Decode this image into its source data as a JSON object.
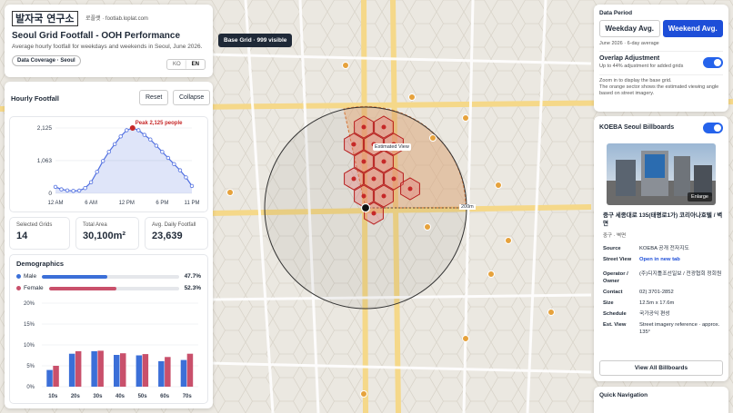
{
  "header": {
    "logo_text": "발자국 연구소",
    "logo_url": "로플랫 · footlab.loplat.com",
    "title": "Seoul Grid Footfall - OOH Performance",
    "subtitle": "Average hourly footfall for weekdays and weekends in Seoul, June 2026.",
    "coverage_label": "Data Coverage · Seoul",
    "lang_ko": "KO",
    "lang_en": "EN",
    "lang_selected": "EN"
  },
  "map": {
    "badge": "Base Grid · 999 visible",
    "view_label": "Estimated View",
    "radius_label": "200m",
    "colors": {
      "hex_fill": "#e57373",
      "hex_stroke": "#b71c1c",
      "sector": "#f4b27a",
      "poi": "#e6a23c"
    }
  },
  "hourly": {
    "title": "Hourly Footfall",
    "reset_label": "Reset",
    "collapse_label": "Collapse",
    "peak_label": "Peak 2,125 people"
  },
  "stats": {
    "selected_grids_label": "Selected Grids",
    "selected_grids_value": "14",
    "total_area_label": "Total Area",
    "total_area_value": "30,100m²",
    "avg_footfall_label": "Avg. Daily Footfall",
    "avg_footfall_value": "23,639"
  },
  "demographics": {
    "title": "Demographics",
    "male_label": "Male",
    "male_pct": "47.7%",
    "male_value": 47.7,
    "female_label": "Female",
    "female_pct": "52.3%",
    "female_value": 52.3,
    "male_color": "#3b6fd8",
    "female_color": "#c9506b"
  },
  "chart_data": [
    {
      "type": "area",
      "x": [
        0,
        1,
        2,
        3,
        4,
        5,
        6,
        7,
        8,
        9,
        10,
        11,
        12,
        13,
        14,
        15,
        16,
        17,
        18,
        19,
        20,
        21,
        22,
        23
      ],
      "values": [
        210,
        130,
        95,
        80,
        90,
        170,
        360,
        700,
        1050,
        1350,
        1600,
        1850,
        2050,
        2125,
        2050,
        1900,
        1750,
        1550,
        1350,
        1150,
        950,
        750,
        520,
        240
      ],
      "xticks": [
        "12 AM",
        "6 AM",
        "12 PM",
        "6 PM",
        "11 PM"
      ],
      "xtick_positions": [
        0,
        6,
        12,
        18,
        23
      ],
      "yticks": [
        "0",
        "1,063",
        "2,125"
      ],
      "ytick_values": [
        0,
        1063,
        2125
      ],
      "ylim": [
        0,
        2125
      ],
      "peak_index": 13,
      "color": "#4f6ee0"
    },
    {
      "type": "bar",
      "categories": [
        "10s",
        "20s",
        "30s",
        "40s",
        "50s",
        "60s",
        "70s"
      ],
      "series": [
        {
          "name": "Male",
          "values": [
            4.0,
            7.9,
            8.5,
            7.6,
            7.5,
            6.1,
            6.4
          ],
          "color": "#3b6fd8"
        },
        {
          "name": "Female",
          "values": [
            5.0,
            8.5,
            8.6,
            8.0,
            7.8,
            7.1,
            7.9
          ],
          "color": "#c9506b"
        }
      ],
      "yticks": [
        "0%",
        "5%",
        "10%",
        "15%",
        "20%"
      ],
      "ytick_values": [
        0,
        5,
        10,
        15,
        20
      ],
      "ylim": [
        0,
        20
      ]
    }
  ],
  "period": {
    "title": "Data Period",
    "weekday_label": "Weekday Avg.",
    "weekend_label": "Weekend Avg.",
    "selected": "weekend",
    "period_text": "June 2026 · 6-day average",
    "overlap_title": "Overlap Adjustment",
    "overlap_sub": "Up to 44% adjustment for added grids",
    "hint1": "Zoom in to display the base grid.",
    "hint2": "The orange sector shows the estimated viewing angle based on street imagery."
  },
  "billboards": {
    "title": "KOEBA Seoul Billboards",
    "enlarge_label": "Enlarge",
    "address": "중구 세종대로 135(태평로1가) 코리아나호텔 / 벽면",
    "district": "중구 · 벽면",
    "rows": [
      {
        "k": "Source",
        "v": "KOEBA 공개 전자지도"
      },
      {
        "k": "Street View",
        "v": "Open in new tab"
      },
      {
        "k": "Operator / Owner",
        "v": "(주)디지틀조선일보 / 전광협회 정회원"
      },
      {
        "k": "Contact",
        "v": "02) 3701-2852"
      },
      {
        "k": "Size",
        "v": "12.5m x 17.6m"
      },
      {
        "k": "Schedule",
        "v": "국가공익 편성"
      },
      {
        "k": "Est. View",
        "v": "Street imagery reference · approx. 135°"
      }
    ],
    "view_all_label": "View All Billboards"
  },
  "quicknav": {
    "title": "Quick Navigation"
  }
}
